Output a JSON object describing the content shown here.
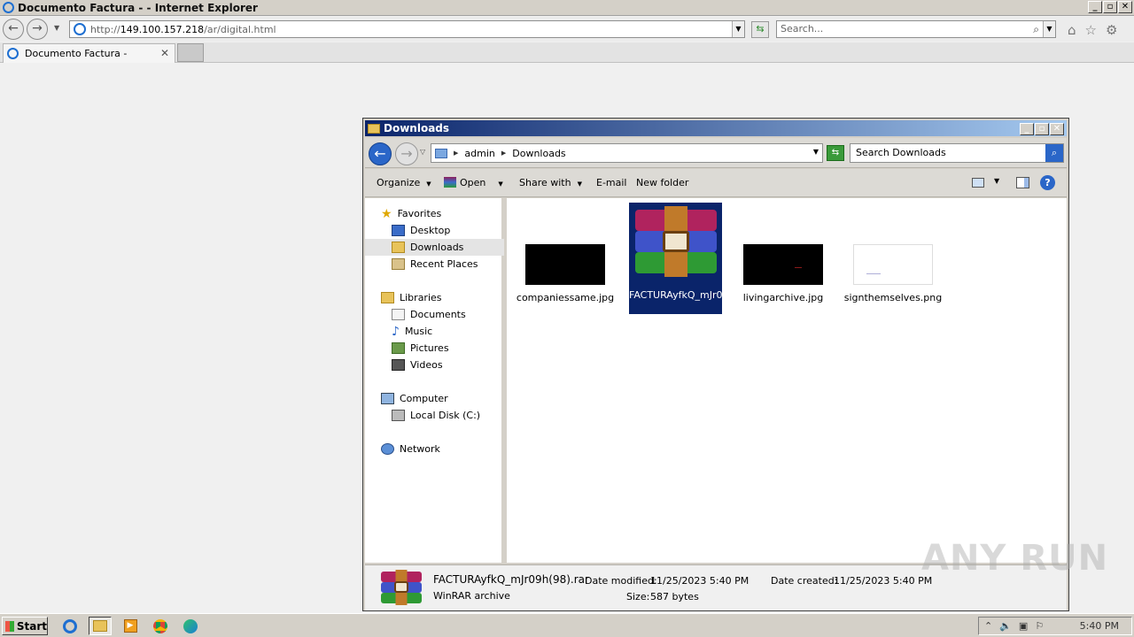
{
  "browser": {
    "window_title": "Documento Factura - - Internet Explorer",
    "url_prefix": "http://",
    "url_host": "149.100.157.218",
    "url_path": "/ar/digital.html",
    "search_placeholder": "Search...",
    "tab_title": "Documento Factura -"
  },
  "explorer": {
    "title": "Downloads",
    "breadcrumb": [
      "admin",
      "Downloads"
    ],
    "search_placeholder": "Search Downloads",
    "commands": {
      "organize": "Organize",
      "open": "Open",
      "share": "Share with",
      "email": "E-mail",
      "new_folder": "New folder"
    },
    "nav": {
      "favorites": "Favorites",
      "desktop": "Desktop",
      "downloads": "Downloads",
      "recent": "Recent Places",
      "libraries": "Libraries",
      "documents": "Documents",
      "music": "Music",
      "pictures": "Pictures",
      "videos": "Videos",
      "computer": "Computer",
      "local_disk": "Local Disk (C:)",
      "network": "Network"
    },
    "files": [
      {
        "name": "companiessame.jpg",
        "thumb": "black"
      },
      {
        "name": "FACTURAyfkQ_mJr09h(98).rar",
        "thumb": "winrar",
        "selected": true
      },
      {
        "name": "livingarchive.jpg",
        "thumb": "black"
      },
      {
        "name": "signthemselves.png",
        "thumb": "white"
      }
    ],
    "status": {
      "file_name": "FACTURAyfkQ_mJr09h(98).rar",
      "file_type": "WinRAR archive",
      "date_modified_label": "Date modified:",
      "date_modified": "11/25/2023 5:40 PM",
      "size_label": "Size:",
      "size": "587 bytes",
      "date_created_label": "Date created:",
      "date_created": "11/25/2023 5:40 PM"
    }
  },
  "taskbar": {
    "start_label": "Start",
    "clock": "5:40 PM",
    "apps": [
      "ie-icon",
      "explorer-icon",
      "media-player-icon",
      "chrome-icon",
      "edge-icon"
    ]
  },
  "watermark": "ANY RUN"
}
